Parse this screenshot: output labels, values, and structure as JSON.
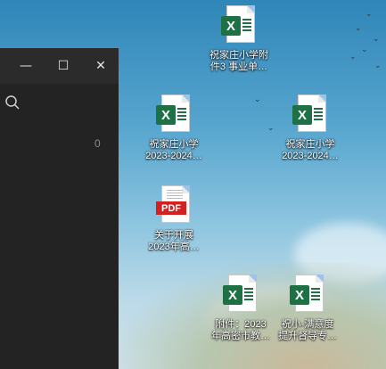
{
  "window": {
    "minimize_glyph": "—",
    "maximize_glyph": "☐",
    "close_glyph": "✕",
    "count": "0"
  },
  "desktop": {
    "icons": [
      {
        "type": "excel",
        "label": "祝家庄小学附\n件3 事业单…"
      },
      {
        "type": "excel",
        "label": "祝家庄小学\n2023-2024…"
      },
      {
        "type": "excel",
        "label": "祝家庄小学\n2023-2024…"
      },
      {
        "type": "pdf",
        "label": "关于开展\n2023年高…"
      },
      {
        "type": "excel",
        "label": "附件：2023\n年高密市教…"
      },
      {
        "type": "excel",
        "label": "祝小-满意度\n提升督导专…"
      }
    ]
  },
  "icon_glyphs": {
    "excel": "X",
    "pdf": "PDF"
  },
  "colors": {
    "excel_green": "#1e7145",
    "pdf_red": "#d32020",
    "window_bg": "#202020"
  }
}
